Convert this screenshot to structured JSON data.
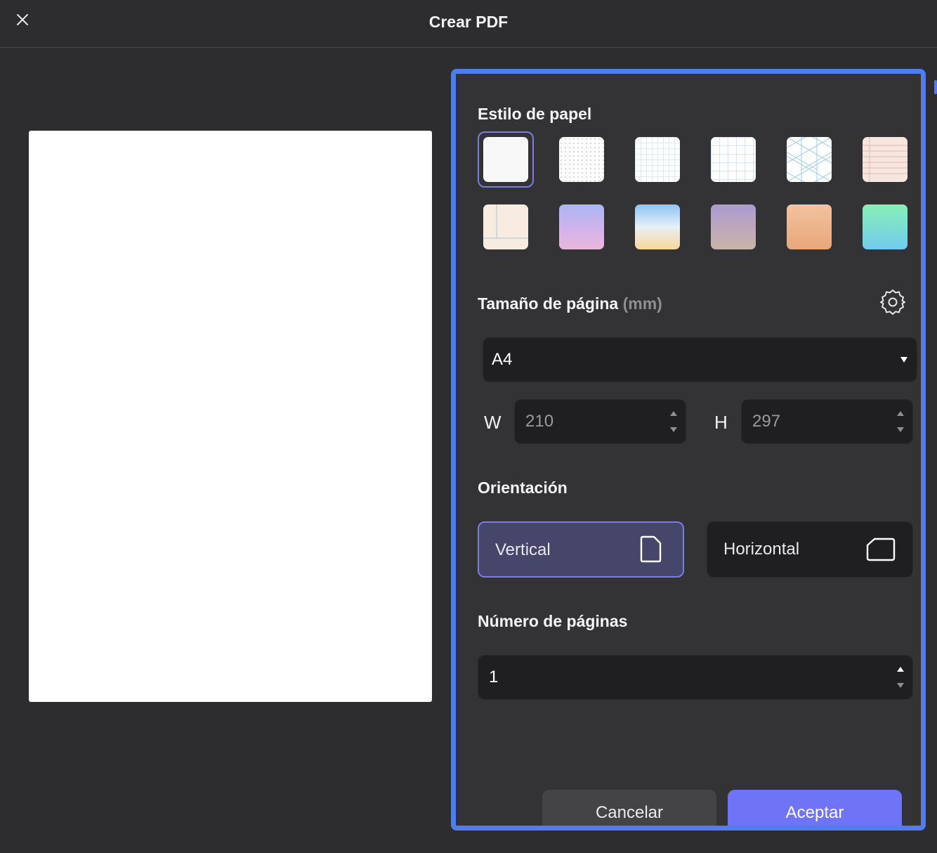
{
  "window": {
    "title": "Crear PDF",
    "close_icon": "close-icon"
  },
  "paper_style": {
    "title": "Estilo de papel",
    "selected_index": 0,
    "swatches": [
      {
        "name": "blank",
        "color": "#f7f7f7"
      },
      {
        "name": "dotted",
        "color": "#ffffff"
      },
      {
        "name": "grid-small",
        "color": "#ffffff"
      },
      {
        "name": "grid-large",
        "color": "#ffffff"
      },
      {
        "name": "isometric",
        "color": "#ffffff"
      },
      {
        "name": "lined-peach",
        "color": "#f6e6dd"
      },
      {
        "name": "cornell-cream",
        "color": "#f8ece0"
      },
      {
        "name": "gradient-lavender",
        "color": "#c8b7f1"
      },
      {
        "name": "gradient-sky-sand",
        "color": "#f5e2b4"
      },
      {
        "name": "gradient-mauve",
        "color": "#b8a5c2"
      },
      {
        "name": "gradient-apricot",
        "color": "#e9a878"
      },
      {
        "name": "gradient-mint-sky",
        "color": "#7fd6e6"
      }
    ]
  },
  "page_size": {
    "title": "Tamaño de página",
    "unit": "(mm)",
    "settings_icon": "gear-icon",
    "selected": "A4",
    "width_label": "W",
    "width": "210",
    "height_label": "H",
    "height": "297"
  },
  "orientation": {
    "title": "Orientación",
    "options": [
      {
        "label": "Vertical",
        "icon": "portrait-page-icon",
        "selected": true
      },
      {
        "label": "Horizontal",
        "icon": "landscape-page-icon",
        "selected": false
      }
    ]
  },
  "page_count": {
    "title": "Número de páginas",
    "value": "1"
  },
  "actions": {
    "cancel": "Cancelar",
    "accept": "Aceptar"
  },
  "colors": {
    "accent": "#6f74f6",
    "panel_border": "#4f7dee",
    "background": "#2d2d2f"
  }
}
